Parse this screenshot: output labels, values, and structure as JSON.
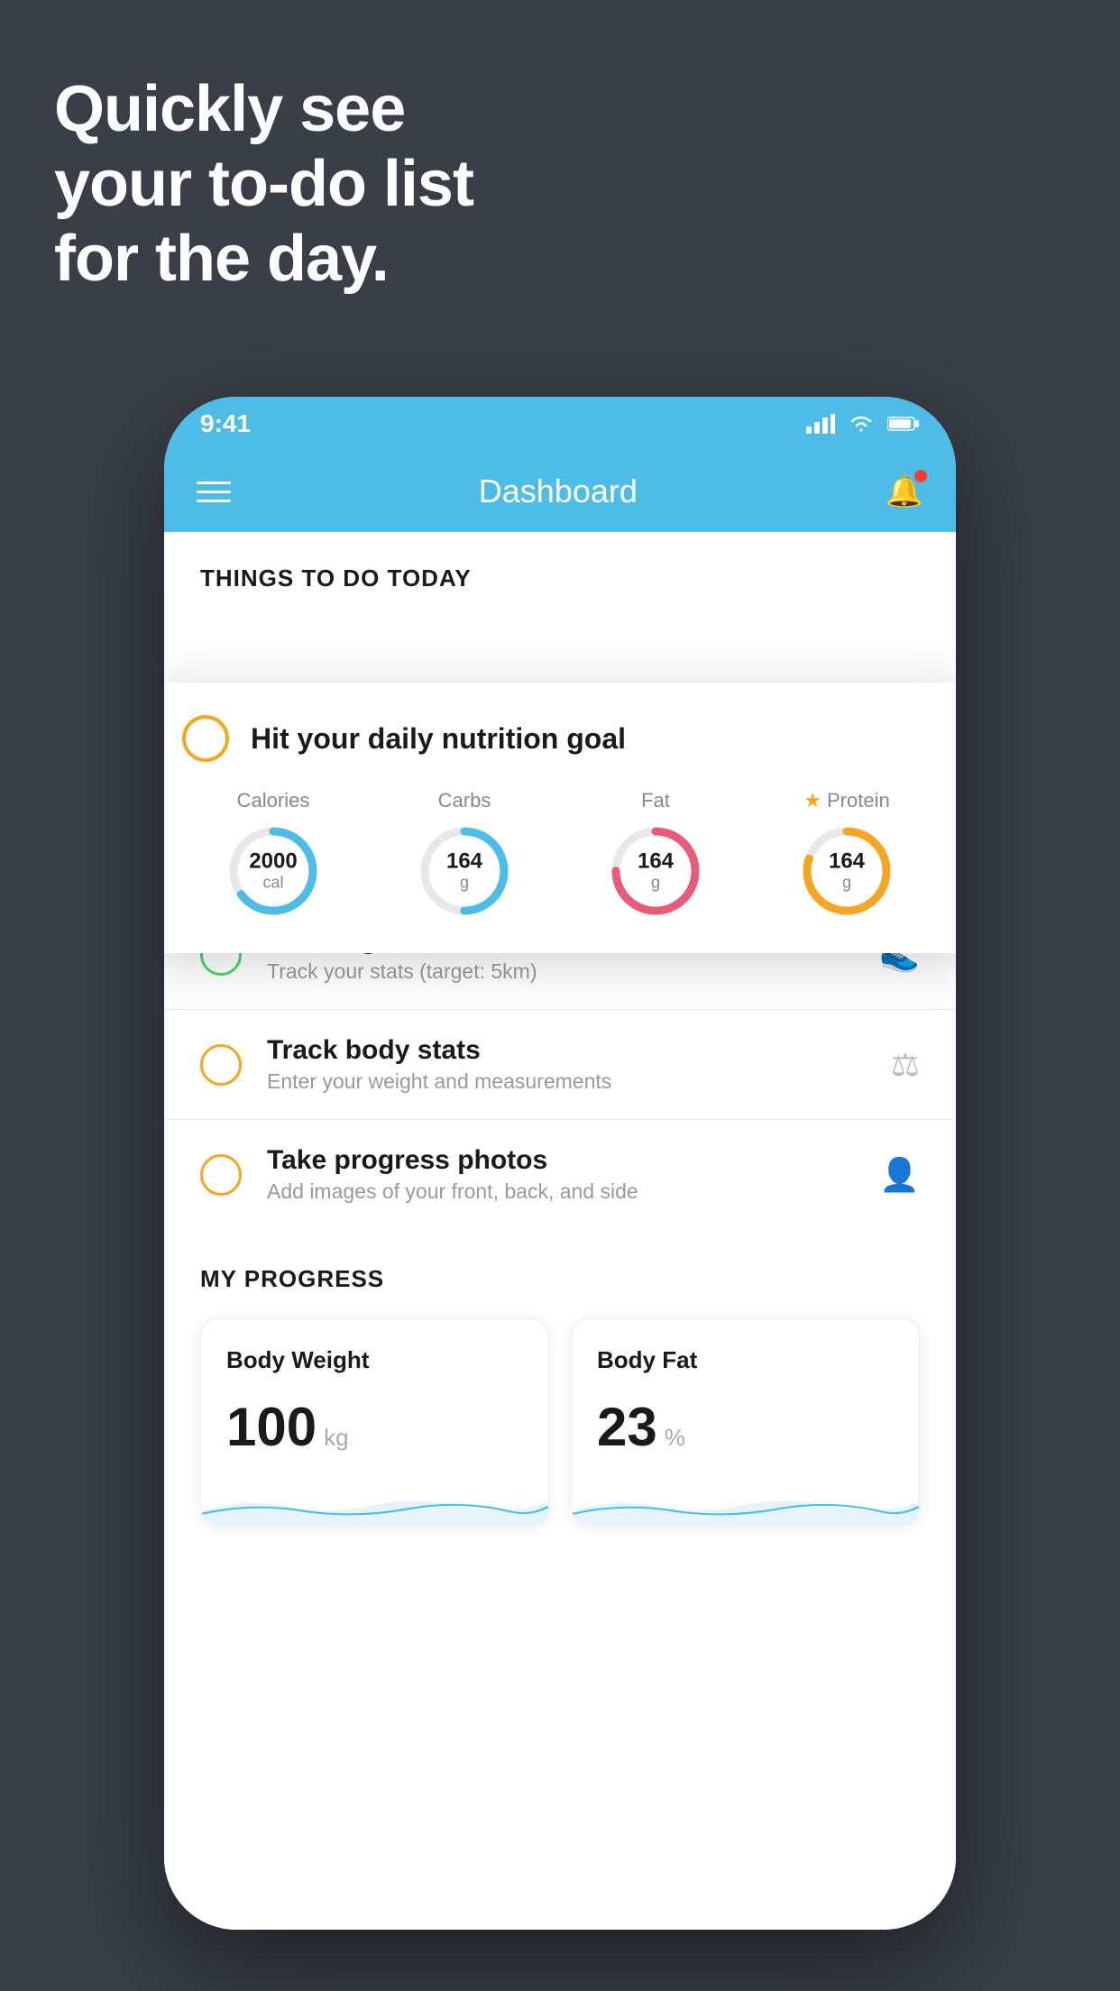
{
  "hero": {
    "line1": "Quickly see",
    "line2": "your to-do list",
    "line3": "for the day."
  },
  "status_bar": {
    "time": "9:41"
  },
  "nav": {
    "title": "Dashboard"
  },
  "things_today": {
    "header": "THINGS TO DO TODAY"
  },
  "floating_card": {
    "title": "Hit your daily nutrition goal",
    "nutrition": [
      {
        "label": "Calories",
        "value": "2000",
        "unit": "cal",
        "color": "#4dbde8",
        "star": false,
        "percent": 65
      },
      {
        "label": "Carbs",
        "value": "164",
        "unit": "g",
        "color": "#4dbde8",
        "star": false,
        "percent": 50
      },
      {
        "label": "Fat",
        "value": "164",
        "unit": "g",
        "color": "#e85c7a",
        "star": false,
        "percent": 75
      },
      {
        "label": "Protein",
        "value": "164",
        "unit": "g",
        "color": "#f5a623",
        "star": true,
        "percent": 80
      }
    ]
  },
  "todo_items": [
    {
      "title": "Running",
      "sub": "Track your stats (target: 5km)",
      "circle_color": "green",
      "icon": "👟"
    },
    {
      "title": "Track body stats",
      "sub": "Enter your weight and measurements",
      "circle_color": "yellow",
      "icon": "⚖"
    },
    {
      "title": "Take progress photos",
      "sub": "Add images of your front, back, and side",
      "circle_color": "yellow",
      "icon": "👤"
    }
  ],
  "progress": {
    "header": "MY PROGRESS",
    "cards": [
      {
        "title": "Body Weight",
        "value": "100",
        "unit": "kg"
      },
      {
        "title": "Body Fat",
        "value": "23",
        "unit": "%"
      }
    ]
  }
}
